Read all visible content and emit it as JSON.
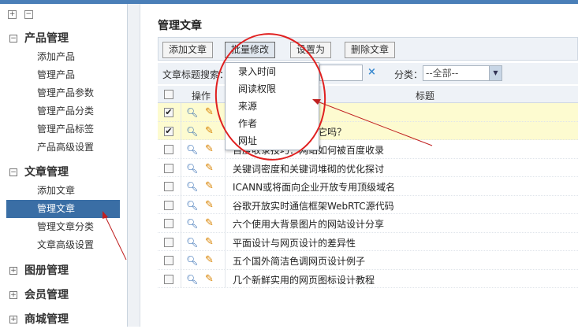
{
  "sidebar": {
    "groups": [
      {
        "label": "产品管理",
        "expander": "−",
        "items": [
          "添加产品",
          "管理产品",
          "管理产品参数",
          "管理产品分类",
          "管理产品标签",
          "产品高级设置"
        ]
      },
      {
        "label": "文章管理",
        "expander": "−",
        "items": [
          "添加文章",
          "管理文章",
          "管理文章分类",
          "文章高级设置"
        ]
      },
      {
        "label": "图册管理",
        "expander": "+"
      },
      {
        "label": "会员管理",
        "expander": "+"
      },
      {
        "label": "商城管理",
        "expander": "+"
      }
    ]
  },
  "page_title": "管理文章",
  "toolbar": {
    "add": "添加文章",
    "batch": "批量修改",
    "set_as": "设置为",
    "delete": "删除文章"
  },
  "search": {
    "label": "文章标题搜索：",
    "clear": "×",
    "category_label": "分类：",
    "category_value": "--全部--"
  },
  "table": {
    "headers": {
      "op": "操作",
      "title": "标题"
    },
    "rows": [
      {
        "checked": "✔",
        "title": ""
      },
      {
        "checked": "✔",
        "title": "的Tag标签吗 能用好它吗？"
      },
      {
        "checked": "",
        "title": "百度收录技巧：网站如何被百度收录"
      },
      {
        "checked": "",
        "title": "关键词密度和关键词堆砌的优化探讨"
      },
      {
        "checked": "",
        "title": "ICANN或将面向企业开放专用顶级域名"
      },
      {
        "checked": "",
        "title": "谷歌开放实时通信框架WebRTC源代码"
      },
      {
        "checked": "",
        "title": "六个使用大背景图片的网站设计分享"
      },
      {
        "checked": "",
        "title": "平面设计与网页设计的差异性"
      },
      {
        "checked": "",
        "title": "五个国外简洁色调网页设计例子"
      },
      {
        "checked": "",
        "title": "几个新鲜实用的网页图标设计教程"
      }
    ]
  },
  "dropdown": {
    "items": [
      "录入时间",
      "阅读权限",
      "来源",
      "作者",
      "网址"
    ]
  },
  "icons": {
    "view": "magnifier-icon",
    "edit": "pencil-icon"
  },
  "colors": {
    "accent": "#3a6ea5",
    "highlight_row": "#fdfbd0",
    "annotation": "#e02020"
  }
}
